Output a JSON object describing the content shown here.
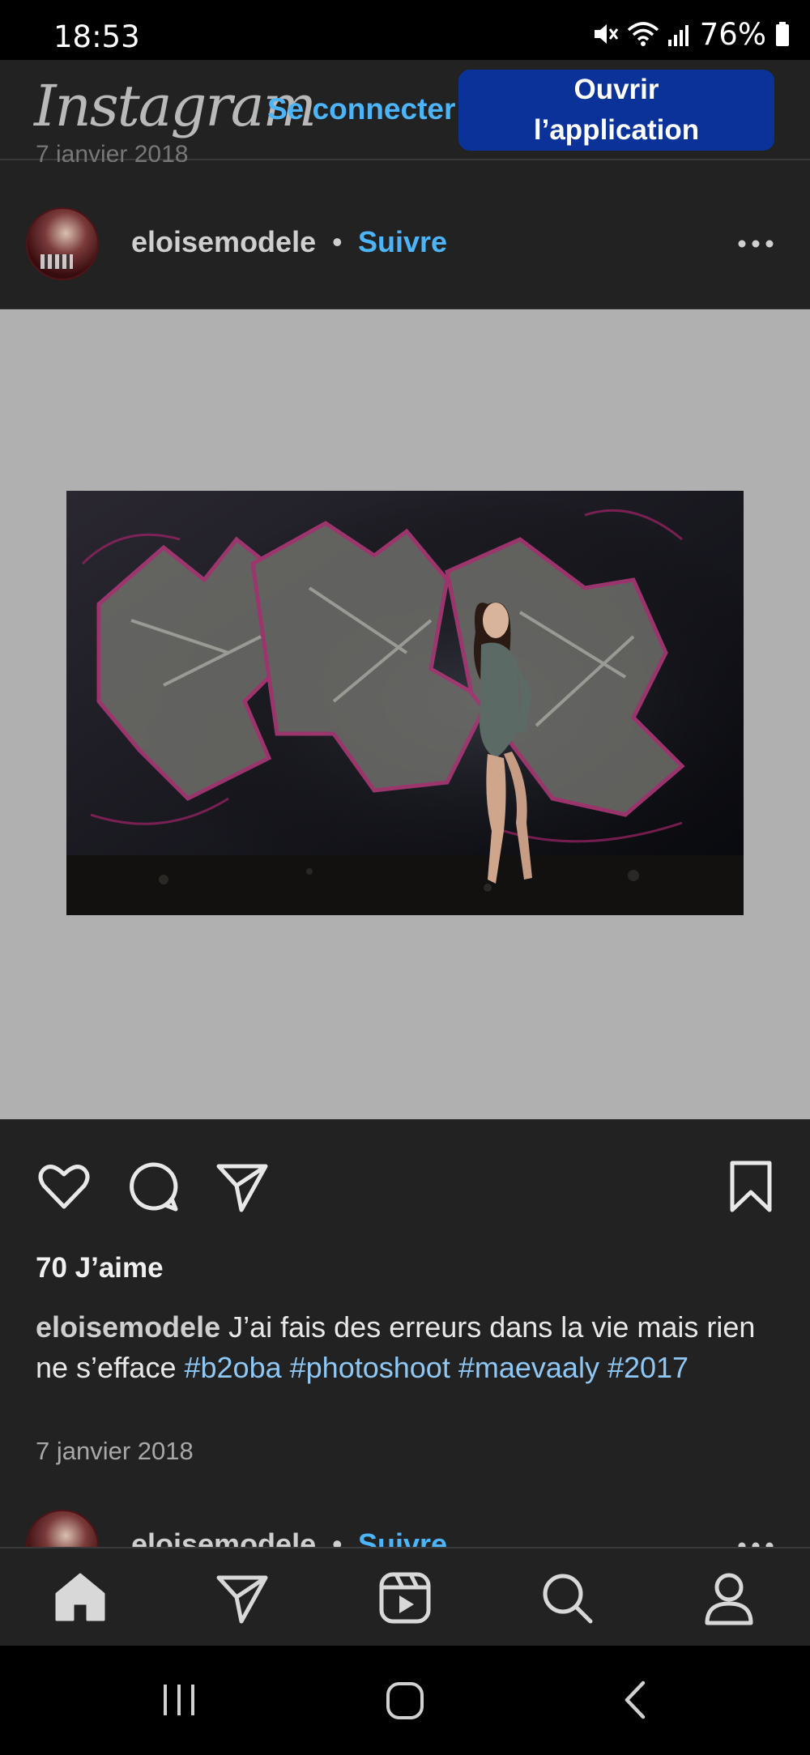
{
  "status_bar": {
    "time": "18:53",
    "battery": "76%",
    "icons": [
      "mute-icon",
      "wifi-icon",
      "signal-icon",
      "battery-icon"
    ]
  },
  "header": {
    "logo": "Instagram",
    "login_label": "Se connecter",
    "open_app_line1": "Ouvrir",
    "open_app_line2": "l’application"
  },
  "partial_top_date": "7 janvier 2018",
  "post": {
    "username": "eloisemodele",
    "separator": "•",
    "follow_label": "Suivre",
    "likes": "70 J’aime",
    "caption_text": "J’ai fais des erreurs dans la vie mais rien ne s’efface",
    "hashtags": [
      "#b2oba",
      "#photoshoot",
      "#maevaaly",
      "#2017"
    ],
    "date": "7 janvier 2018"
  },
  "next_post": {
    "username": "eloisemodele",
    "separator": "•",
    "follow_label": "Suivre"
  },
  "bottom_nav": [
    "home-icon",
    "direct-icon",
    "reels-icon",
    "search-icon",
    "profile-icon"
  ],
  "colors": {
    "background": "#222222",
    "link": "#4cb5f9",
    "hashtag": "#8fc7f5",
    "button": "#0a3299",
    "media_background": "#b0b0b0"
  }
}
